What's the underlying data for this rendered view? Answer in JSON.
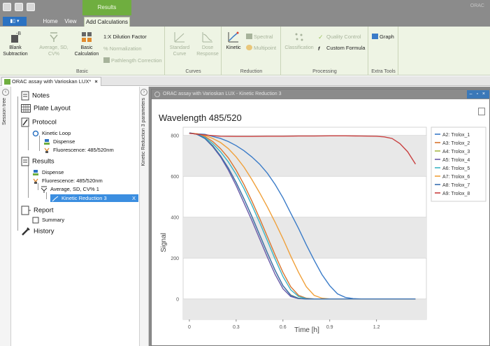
{
  "app": {
    "context_tab_title": "Results",
    "app_title": "ORAC"
  },
  "ribbon_tabs": {
    "file": "▮▯ ▾",
    "home": "Home",
    "view": "View",
    "add_calc": "Add Calculations"
  },
  "groups": {
    "basic": {
      "label": "Basic",
      "blank": "Blank\nSubtraction",
      "avg": "Average, SD,\nCV%",
      "basic_calc": "Basic\nCalculation",
      "dilution": "1:X Dilution Factor",
      "normalization": "% Normalization",
      "pathlength": "Pathlength Correction"
    },
    "curves": {
      "label": "Curves",
      "standard": "Standard\nCurve",
      "dose": "Dose\nResponse"
    },
    "reduction": {
      "label": "Reduction",
      "kinetic": "Kinetic",
      "spectral": "Spectral",
      "multipoint": "Multipoint"
    },
    "processing": {
      "label": "Processing",
      "classification": "Classification",
      "quality": "Quality Control",
      "custom": "Custom Formula"
    },
    "extra": {
      "label": "Extra Tools",
      "graph": "Graph"
    }
  },
  "doc_tab": {
    "label": "ORAC assay with Varioskan LUX*",
    "close": "×"
  },
  "session_tree": {
    "label": "Session tree",
    "items": {
      "notes": "Notes",
      "plate_layout": "Plate Layout",
      "protocol": "Protocol",
      "kinetic_loop": "Kinetic Loop",
      "dispense": "Dispense",
      "fluorescence": "Fluorescence: 485/520nm",
      "results": "Results",
      "r_dispense": "Dispense",
      "r_fluorescence": "Fluorescence: 485/520nm",
      "avg": "Average, SD, CV% 1",
      "kinetic_red": "Kinetic Reduction 3",
      "kinetic_red_close": "X",
      "report": "Report",
      "summary": "Summary",
      "history": "History"
    }
  },
  "params_panel": {
    "label": "Kinetic Reduction 3 parameters"
  },
  "child_window": {
    "title": "ORAC assay with Varioskan LUX - Kinetic Reduction 3",
    "buttons": "– ▫ ×"
  },
  "chart_data": {
    "type": "line",
    "title": "Wavelength 485/520",
    "xlabel": "Time [h]",
    "ylabel": "Signal",
    "xlim": [
      -0.04,
      1.52
    ],
    "ylim": [
      -100,
      840
    ],
    "xticks": [
      0,
      0.3,
      0.6,
      0.9,
      1.2
    ],
    "xtick_labels": [
      "0",
      "0.3",
      "0.6",
      "0.9",
      "1.2"
    ],
    "yticks": [
      0,
      200,
      400,
      600,
      800
    ],
    "grid": "alternating horizontal bands",
    "legend_position": "right",
    "series": [
      {
        "name": "A2: Trolox_1",
        "color": "#3a7bc8",
        "points": [
          [
            0,
            810
          ],
          [
            0.05,
            808
          ],
          [
            0.1,
            805
          ],
          [
            0.15,
            795
          ],
          [
            0.2,
            785
          ],
          [
            0.25,
            770
          ],
          [
            0.3,
            750
          ],
          [
            0.35,
            725
          ],
          [
            0.4,
            695
          ],
          [
            0.45,
            660
          ],
          [
            0.5,
            615
          ],
          [
            0.55,
            560
          ],
          [
            0.6,
            495
          ],
          [
            0.65,
            420
          ],
          [
            0.7,
            345
          ],
          [
            0.75,
            265
          ],
          [
            0.8,
            190
          ],
          [
            0.85,
            120
          ],
          [
            0.9,
            65
          ],
          [
            0.95,
            25
          ],
          [
            1.0,
            8
          ],
          [
            1.05,
            2
          ],
          [
            1.1,
            0
          ],
          [
            1.2,
            0
          ],
          [
            1.3,
            0
          ],
          [
            1.4,
            0
          ],
          [
            1.45,
            0
          ]
        ]
      },
      {
        "name": "A3: Trolox_2",
        "color": "#d9742f",
        "points": [
          [
            0,
            812
          ],
          [
            0.05,
            808
          ],
          [
            0.1,
            795
          ],
          [
            0.15,
            770
          ],
          [
            0.2,
            735
          ],
          [
            0.25,
            690
          ],
          [
            0.3,
            630
          ],
          [
            0.35,
            560
          ],
          [
            0.4,
            480
          ],
          [
            0.45,
            395
          ],
          [
            0.5,
            305
          ],
          [
            0.55,
            215
          ],
          [
            0.6,
            130
          ],
          [
            0.65,
            60
          ],
          [
            0.7,
            18
          ],
          [
            0.75,
            4
          ],
          [
            0.8,
            0
          ],
          [
            0.9,
            0
          ],
          [
            1.0,
            0
          ],
          [
            1.1,
            0
          ],
          [
            1.2,
            0
          ],
          [
            1.3,
            0
          ],
          [
            1.4,
            0
          ],
          [
            1.45,
            0
          ]
        ]
      },
      {
        "name": "A4: Trolox_3",
        "color": "#a8b84a",
        "points": [
          [
            0,
            812
          ],
          [
            0.05,
            805
          ],
          [
            0.1,
            785
          ],
          [
            0.15,
            750
          ],
          [
            0.2,
            700
          ],
          [
            0.25,
            640
          ],
          [
            0.3,
            570
          ],
          [
            0.35,
            490
          ],
          [
            0.4,
            405
          ],
          [
            0.45,
            315
          ],
          [
            0.5,
            225
          ],
          [
            0.55,
            140
          ],
          [
            0.6,
            65
          ],
          [
            0.65,
            20
          ],
          [
            0.7,
            4
          ],
          [
            0.75,
            0
          ],
          [
            0.8,
            0
          ],
          [
            0.9,
            0
          ],
          [
            1.0,
            0
          ],
          [
            1.1,
            0
          ],
          [
            1.2,
            0
          ],
          [
            1.3,
            0
          ],
          [
            1.4,
            0
          ],
          [
            1.45,
            0
          ]
        ]
      },
      {
        "name": "A5: Trolox_4",
        "color": "#6a5aa8",
        "points": [
          [
            0,
            812
          ],
          [
            0.05,
            805
          ],
          [
            0.1,
            785
          ],
          [
            0.15,
            745
          ],
          [
            0.2,
            695
          ],
          [
            0.25,
            630
          ],
          [
            0.3,
            555
          ],
          [
            0.35,
            470
          ],
          [
            0.4,
            385
          ],
          [
            0.45,
            295
          ],
          [
            0.5,
            205
          ],
          [
            0.55,
            120
          ],
          [
            0.6,
            50
          ],
          [
            0.65,
            12
          ],
          [
            0.7,
            2
          ],
          [
            0.75,
            0
          ],
          [
            0.8,
            0
          ],
          [
            0.9,
            0
          ],
          [
            1.0,
            0
          ],
          [
            1.1,
            0
          ],
          [
            1.2,
            0
          ],
          [
            1.3,
            0
          ],
          [
            1.4,
            0
          ],
          [
            1.45,
            0
          ]
        ]
      },
      {
        "name": "A6: Trolox_5",
        "color": "#3bb4c4",
        "points": [
          [
            0,
            812
          ],
          [
            0.05,
            805
          ],
          [
            0.1,
            790
          ],
          [
            0.15,
            760
          ],
          [
            0.2,
            720
          ],
          [
            0.25,
            670
          ],
          [
            0.3,
            610
          ],
          [
            0.35,
            540
          ],
          [
            0.4,
            460
          ],
          [
            0.45,
            375
          ],
          [
            0.5,
            285
          ],
          [
            0.55,
            195
          ],
          [
            0.6,
            110
          ],
          [
            0.65,
            45
          ],
          [
            0.7,
            12
          ],
          [
            0.75,
            2
          ],
          [
            0.8,
            0
          ],
          [
            0.9,
            0
          ],
          [
            1.0,
            0
          ],
          [
            1.1,
            0
          ],
          [
            1.2,
            0
          ],
          [
            1.3,
            0
          ],
          [
            1.4,
            0
          ],
          [
            1.45,
            0
          ]
        ]
      },
      {
        "name": "A7: Trolox_6",
        "color": "#f0a03a",
        "points": [
          [
            0,
            810
          ],
          [
            0.05,
            808
          ],
          [
            0.1,
            800
          ],
          [
            0.15,
            785
          ],
          [
            0.2,
            765
          ],
          [
            0.25,
            735
          ],
          [
            0.3,
            695
          ],
          [
            0.35,
            645
          ],
          [
            0.4,
            585
          ],
          [
            0.45,
            520
          ],
          [
            0.5,
            450
          ],
          [
            0.55,
            375
          ],
          [
            0.6,
            295
          ],
          [
            0.65,
            210
          ],
          [
            0.7,
            130
          ],
          [
            0.75,
            60
          ],
          [
            0.8,
            18
          ],
          [
            0.85,
            4
          ],
          [
            0.9,
            0
          ],
          [
            1.0,
            0
          ],
          [
            1.1,
            0
          ],
          [
            1.2,
            0
          ],
          [
            1.3,
            0
          ],
          [
            1.4,
            0
          ],
          [
            1.45,
            0
          ]
        ]
      },
      {
        "name": "A8: Trolox_7",
        "color": "#3a6fb0",
        "points": [
          [
            0,
            812
          ],
          [
            0.05,
            805
          ],
          [
            0.1,
            785
          ],
          [
            0.15,
            748
          ],
          [
            0.2,
            700
          ],
          [
            0.25,
            640
          ],
          [
            0.3,
            570
          ],
          [
            0.35,
            490
          ],
          [
            0.4,
            405
          ],
          [
            0.45,
            315
          ],
          [
            0.5,
            225
          ],
          [
            0.55,
            140
          ],
          [
            0.6,
            65
          ],
          [
            0.65,
            18
          ],
          [
            0.7,
            3
          ],
          [
            0.75,
            0
          ],
          [
            0.8,
            0
          ],
          [
            0.9,
            0
          ],
          [
            1.0,
            0
          ],
          [
            1.1,
            0
          ],
          [
            1.2,
            0
          ],
          [
            1.3,
            0
          ],
          [
            1.4,
            0
          ],
          [
            1.45,
            0
          ]
        ]
      },
      {
        "name": "A9: Trolox_8",
        "color": "#c94040",
        "points": [
          [
            0,
            810
          ],
          [
            0.1,
            802
          ],
          [
            0.2,
            796
          ],
          [
            0.3,
            795
          ],
          [
            0.4,
            795
          ],
          [
            0.5,
            796
          ],
          [
            0.6,
            796
          ],
          [
            0.7,
            797
          ],
          [
            0.8,
            797
          ],
          [
            0.9,
            798
          ],
          [
            1.0,
            798
          ],
          [
            1.1,
            797
          ],
          [
            1.2,
            796
          ],
          [
            1.25,
            793
          ],
          [
            1.3,
            785
          ],
          [
            1.35,
            760
          ],
          [
            1.4,
            720
          ],
          [
            1.45,
            660
          ]
        ]
      }
    ]
  }
}
